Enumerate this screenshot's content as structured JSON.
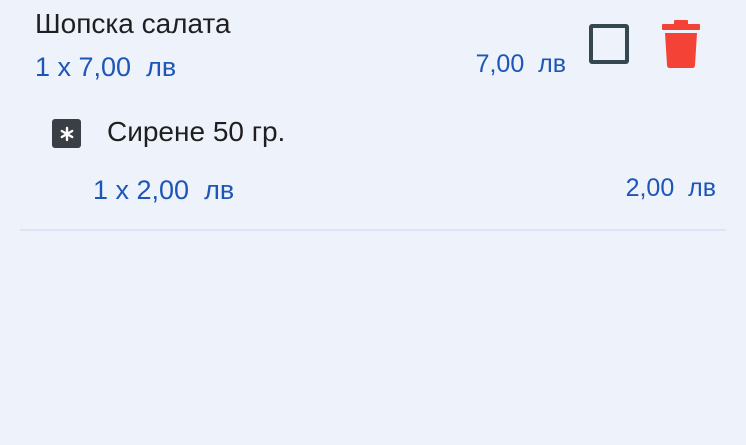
{
  "order_item": {
    "name": "Шопска салата",
    "quantity_price": "1 x 7,00  лв",
    "total": "7,00  лв",
    "checked": false,
    "checkbox_icon": "checkbox-outline-icon",
    "delete_icon": "trash-icon",
    "delete_color": "#f44336",
    "modifier": {
      "icon": "asterisk-icon",
      "name": "Сирене 50 гр.",
      "quantity_price": "1 x 2,00  лв",
      "total": "2,00  лв"
    }
  },
  "colors": {
    "background": "#edf2fb",
    "price_text": "#1e56b8",
    "primary_text": "#1f1f1f"
  }
}
